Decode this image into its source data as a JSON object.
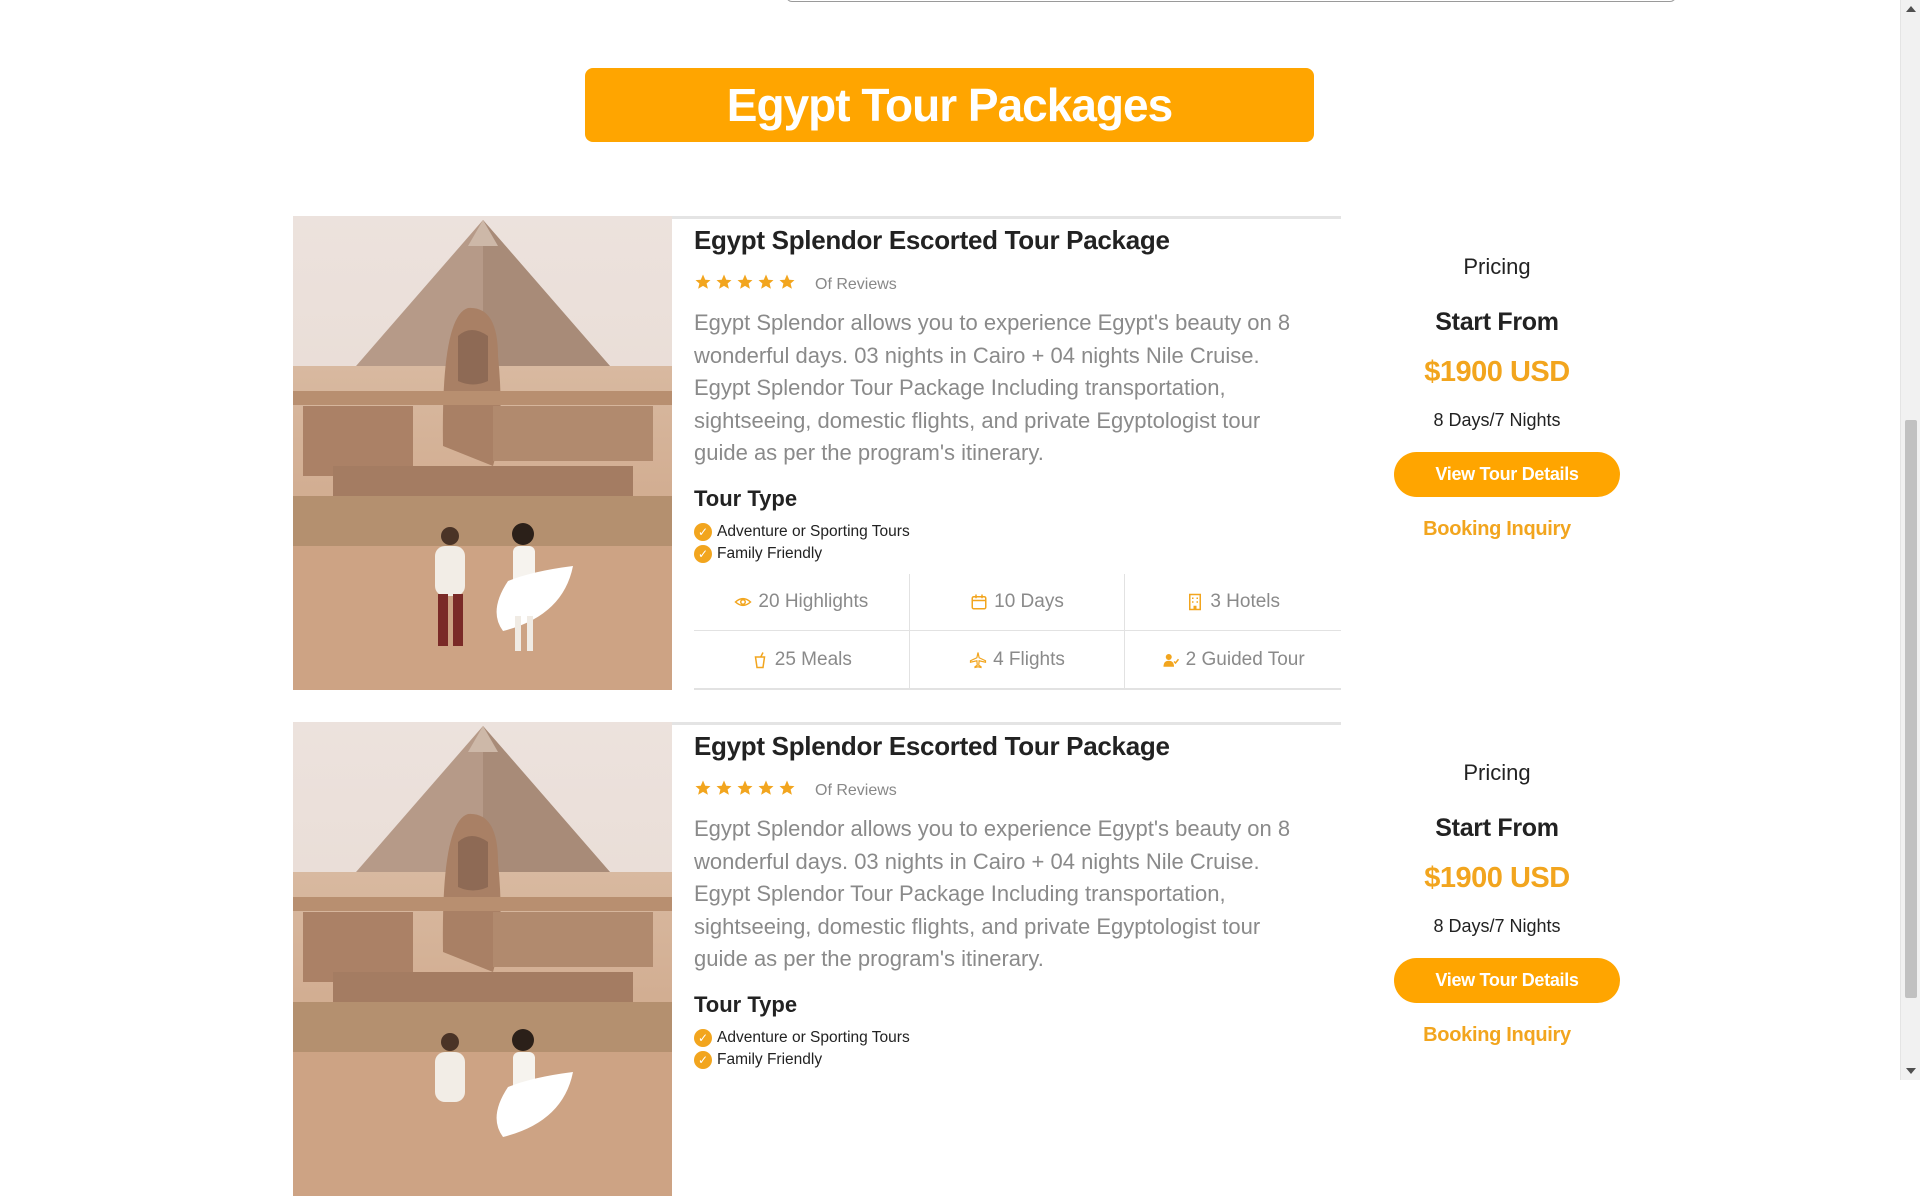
{
  "page": {
    "heading": "Egypt Tour Packages"
  },
  "packages": [
    {
      "title": "Egypt Splendor Escorted Tour Package",
      "rating": 5,
      "reviews_label": "Of Reviews",
      "description": "Egypt Splendor allows you to experience Egypt's beauty on 8 wonderful days. 03 nights in Cairo + 04 nights Nile Cruise. Egypt Splendor Tour Package Including transportation, sightseeing, domestic flights, and private Egyptologist tour guide as per the program's itinerary.",
      "tour_type_heading": "Tour Type",
      "tour_types": [
        "Adventure or Sporting Tours",
        "Family Friendly"
      ],
      "features": [
        {
          "icon": "eye-icon",
          "label": "20 Highlights"
        },
        {
          "icon": "calendar-icon",
          "label": "10 Days"
        },
        {
          "icon": "hotel-icon",
          "label": "3 Hotels"
        },
        {
          "icon": "drink-icon",
          "label": "25 Meals"
        },
        {
          "icon": "plane-icon",
          "label": "4 Flights"
        },
        {
          "icon": "guide-icon",
          "label": "2 Guided Tour"
        }
      ],
      "pricing": {
        "label": "Pricing",
        "start_from": "Start From",
        "price": "$1900 USD",
        "duration": "8 Days/7 Nights",
        "details_button": "View Tour Details",
        "inquiry_link": "Booking Inquiry"
      }
    },
    {
      "title": "Egypt Splendor Escorted Tour Package",
      "rating": 5,
      "reviews_label": "Of Reviews",
      "description": "Egypt Splendor allows you to experience Egypt's beauty on 8 wonderful days. 03 nights in Cairo + 04 nights Nile Cruise. Egypt Splendor Tour Package Including transportation, sightseeing, domestic flights, and private Egyptologist tour guide as per the program's itinerary.",
      "tour_type_heading": "Tour Type",
      "tour_types": [
        "Adventure or Sporting Tours",
        "Family Friendly"
      ],
      "pricing": {
        "label": "Pricing",
        "start_from": "Start From",
        "price": "$1900 USD",
        "duration": "8 Days/7 Nights",
        "details_button": "View Tour Details",
        "inquiry_link": "Booking Inquiry"
      }
    }
  ],
  "colors": {
    "accent": "#ffa500",
    "accent_text": "#f2a51e",
    "muted_text": "#8a8a8a"
  }
}
